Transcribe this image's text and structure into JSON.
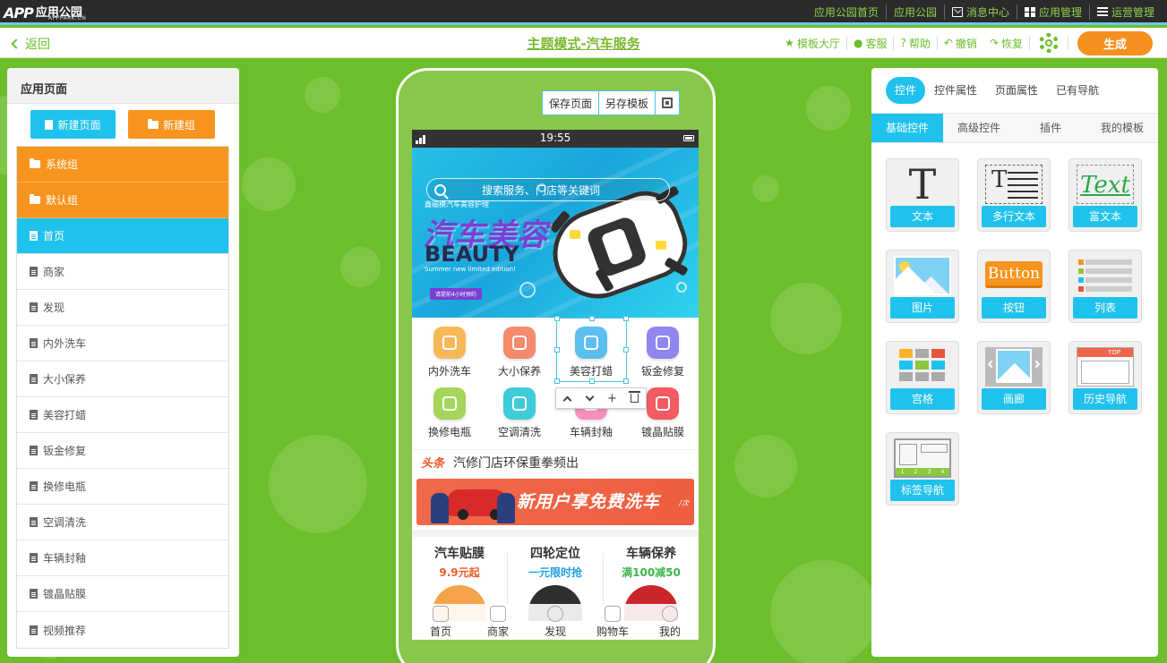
{
  "topbar": {
    "logo_mark": "APP",
    "logo_name": "应用公园",
    "logo_sub": "APPPARK.CN",
    "nav": [
      "应用公园首页",
      "应用公园",
      "消息中心",
      "应用管理",
      "运营管理"
    ]
  },
  "subbar": {
    "back_label": "返回",
    "title": "主题模式-汽车服务",
    "tools": [
      "模板大厅",
      "客服",
      "帮助",
      "撤销",
      "恢复"
    ],
    "generate_label": "生成"
  },
  "left_panel": {
    "title": "应用页面",
    "new_page_label": "新建页面",
    "new_group_label": "新建组",
    "groups": [
      "系统组",
      "默认组"
    ],
    "pages": [
      "首页",
      "商家",
      "发现",
      "内外洗车",
      "大小保养",
      "美容打蜡",
      "钣金修复",
      "换修电瓶",
      "空调清洗",
      "车辆封釉",
      "镀晶贴膜",
      "视频推荐"
    ],
    "active_page": "首页"
  },
  "phone": {
    "actions": [
      "保存页面",
      "另存模板"
    ],
    "status_time": "19:55",
    "search_placeholder": "搜索服务、门店等关键词",
    "banner": {
      "small": "鑫磁模汽车美容护理",
      "title_cn": "汽车美容",
      "title_en": "BEAUTY",
      "subtitle": "Summer new limited edition!",
      "tag": "请提前4小时预约"
    },
    "grid": [
      {
        "label": "内外洗车",
        "color": "#f9b858"
      },
      {
        "label": "大小保养",
        "color": "#f68a6c"
      },
      {
        "label": "美容打蜡",
        "color": "#5cbff0"
      },
      {
        "label": "钣金修复",
        "color": "#8f86f0"
      },
      {
        "label": "换修电瓶",
        "color": "#a3d65a"
      },
      {
        "label": "空调清洗",
        "color": "#3fcbd8"
      },
      {
        "label": "车辆封釉",
        "color": "#f58fbf"
      },
      {
        "label": "镀晶贴膜",
        "color": "#f25b63"
      }
    ],
    "news_tag": "头条",
    "news_text": "汽修门店环保重拳频出",
    "promo_text": "新用户享免费洗车",
    "promo_small": "/次",
    "cards": [
      {
        "title": "汽车贴膜",
        "sub": "9.9元起",
        "color": "#f05a28"
      },
      {
        "title": "四轮定位",
        "sub": "一元限时抢",
        "color": "#1fa0e0"
      },
      {
        "title": "车辆保养",
        "sub": "满100减50",
        "color": "#3cb54a"
      }
    ],
    "tabs": [
      "首页",
      "商家",
      "发现",
      "购物车",
      "我的"
    ]
  },
  "right_panel": {
    "tabs": [
      "控件",
      "控件属性",
      "页面属性",
      "已有导航"
    ],
    "active_tab": "控件",
    "subtabs": [
      "基础控件",
      "高级控件",
      "插件",
      "我的模板"
    ],
    "active_subtab": "基础控件",
    "widget_labels": [
      "文本",
      "多行文本",
      "富文本",
      "图片",
      "按钮",
      "列表",
      "宫格",
      "画廊",
      "历史导航",
      "标签导航"
    ],
    "widget_art_text": {
      "T": "T",
      "rich": "Text",
      "button": "Button",
      "hist_top": "TOP",
      "tab_nums": [
        "1",
        "2",
        "3",
        "4"
      ]
    }
  },
  "colors": {
    "green_bg": "#6cbf2a",
    "accent_blue": "#1fc2ec",
    "accent_orange": "#f7941d"
  }
}
